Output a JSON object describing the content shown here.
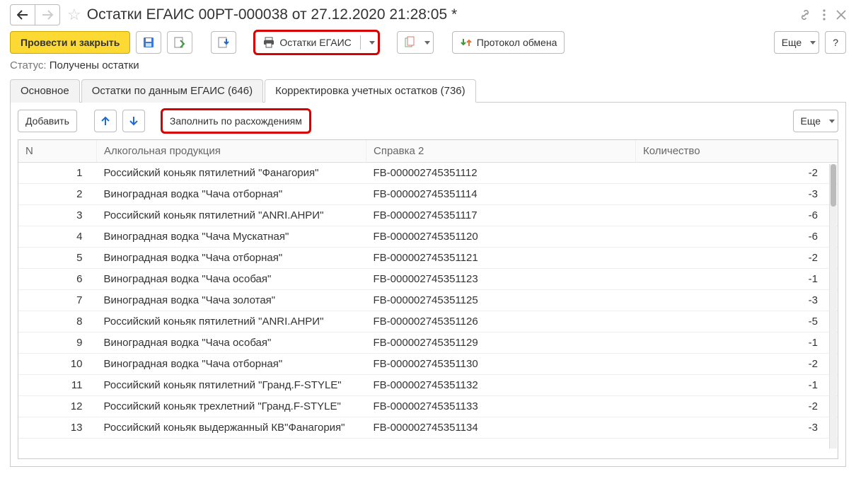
{
  "header": {
    "title": "Остатки ЕГАИС 00РТ-000038 от 27.12.2020 21:28:05 *"
  },
  "toolbar": {
    "post_close": "Провести и закрыть",
    "print_label": "Остатки ЕГАИС",
    "protocol": "Протокол обмена",
    "more": "Еще",
    "help": "?"
  },
  "status": {
    "label": "Статус:",
    "value": "Получены остатки"
  },
  "tabs": [
    {
      "label": "Основное"
    },
    {
      "label": "Остатки по данным ЕГАИС (646)"
    },
    {
      "label": "Корректировка учетных остатков (736)"
    }
  ],
  "inner_toolbar": {
    "add": "Добавить",
    "fill": "Заполнить по расхождениям",
    "more": "Еще"
  },
  "columns": {
    "n": "N",
    "product": "Алкогольная продукция",
    "ref2": "Справка 2",
    "qty": "Количество"
  },
  "rows": [
    {
      "n": "1",
      "product": "Российский коньяк пятилетний \"Фанагория\"",
      "ref2": "FB-000002745351112",
      "qty": "-2"
    },
    {
      "n": "2",
      "product": "Виноградная водка \"Чача отборная\"",
      "ref2": "FB-000002745351114",
      "qty": "-3"
    },
    {
      "n": "3",
      "product": "Российский коньяк пятилетний \"ANRI.АНРИ\"",
      "ref2": "FB-000002745351117",
      "qty": "-6"
    },
    {
      "n": "4",
      "product": "Виноградная водка \"Чача Мускатная\"",
      "ref2": "FB-000002745351120",
      "qty": "-6"
    },
    {
      "n": "5",
      "product": "Виноградная водка \"Чача отборная\"",
      "ref2": "FB-000002745351121",
      "qty": "-2"
    },
    {
      "n": "6",
      "product": "Виноградная водка \"Чача особая\"",
      "ref2": "FB-000002745351123",
      "qty": "-1"
    },
    {
      "n": "7",
      "product": "Виноградная водка \"Чача золотая\"",
      "ref2": "FB-000002745351125",
      "qty": "-3"
    },
    {
      "n": "8",
      "product": "Российский коньяк пятилетний \"ANRI.АНРИ\"",
      "ref2": "FB-000002745351126",
      "qty": "-5"
    },
    {
      "n": "9",
      "product": "Виноградная водка \"Чача особая\"",
      "ref2": "FB-000002745351129",
      "qty": "-1"
    },
    {
      "n": "10",
      "product": "Виноградная водка \"Чача отборная\"",
      "ref2": "FB-000002745351130",
      "qty": "-2"
    },
    {
      "n": "11",
      "product": "Российский коньяк пятилетний \"Гранд.F-STYLE\"",
      "ref2": "FB-000002745351132",
      "qty": "-1"
    },
    {
      "n": "12",
      "product": "Российский коньяк трехлетний \"Гранд.F-STYLE\"",
      "ref2": "FB-000002745351133",
      "qty": "-2"
    },
    {
      "n": "13",
      "product": "Российский коньяк выдержанный КВ\"Фанагория\"",
      "ref2": "FB-000002745351134",
      "qty": "-3"
    }
  ]
}
